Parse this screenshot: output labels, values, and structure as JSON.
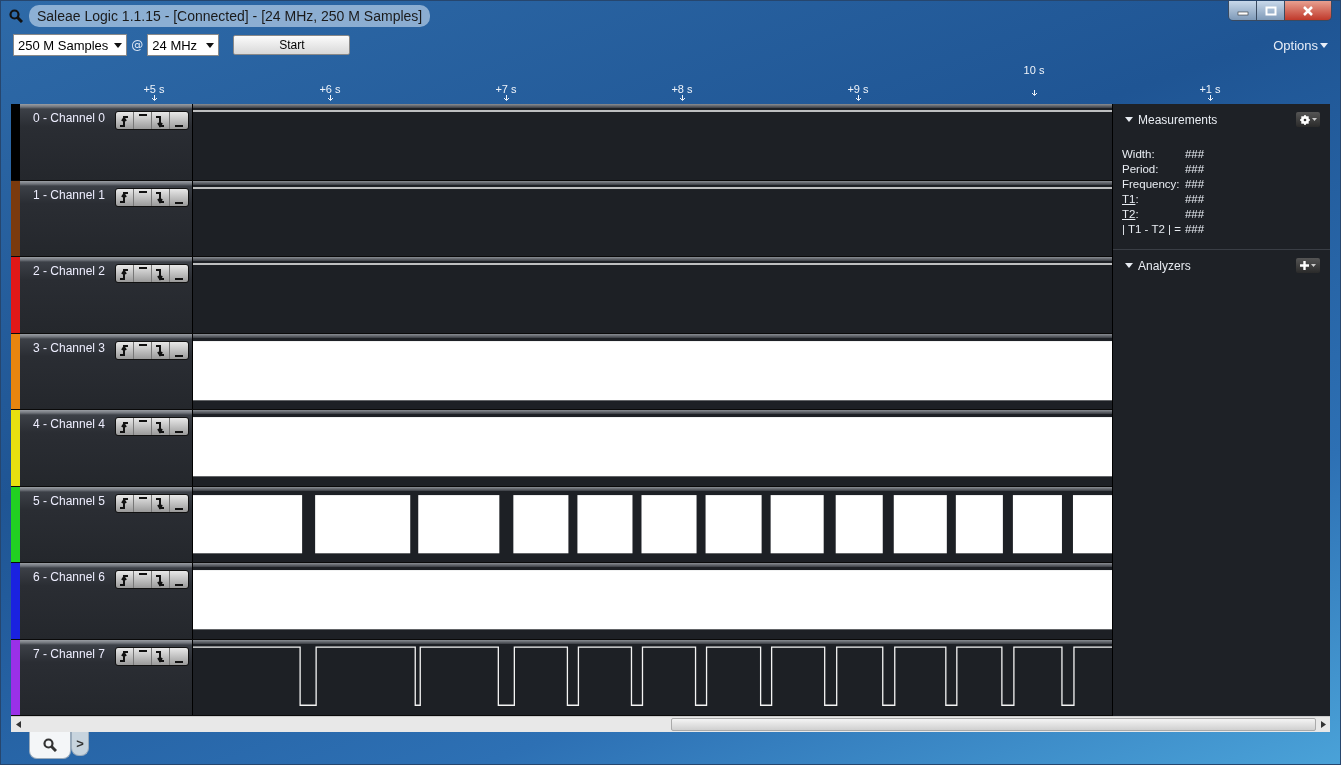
{
  "window": {
    "title": "Saleae Logic 1.1.15 - [Connected] - [24 MHz, 250 M Samples]"
  },
  "toolbar": {
    "samples": "250 M Samples",
    "at": "@",
    "rate": "24 MHz",
    "start": "Start",
    "options": "Options"
  },
  "ruler": [
    {
      "label": "+5 s",
      "kind": "minor"
    },
    {
      "label": "+6 s",
      "kind": "minor"
    },
    {
      "label": "+7 s",
      "kind": "minor"
    },
    {
      "label": "+8 s",
      "kind": "minor"
    },
    {
      "label": "+9 s",
      "kind": "minor"
    },
    {
      "label": "10 s",
      "kind": "major"
    },
    {
      "label": "+1 s",
      "kind": "minor"
    }
  ],
  "channels": [
    {
      "name": "0 - Channel 0",
      "color": "#000000",
      "kind": "idle"
    },
    {
      "name": "1 - Channel 1",
      "color": "#7a3a0e",
      "kind": "idle"
    },
    {
      "name": "2 - Channel 2",
      "color": "#e01818",
      "kind": "idle"
    },
    {
      "name": "3 - Channel 3",
      "color": "#e8850f",
      "kind": "dense"
    },
    {
      "name": "4 - Channel 4",
      "color": "#e8e010",
      "kind": "dense"
    },
    {
      "name": "5 - Channel 5",
      "color": "#22d022",
      "kind": "gapped"
    },
    {
      "name": "6 - Channel 6",
      "color": "#1a22e0",
      "kind": "dense"
    },
    {
      "name": "7 - Channel 7",
      "color": "#9a30e8",
      "kind": "pulses"
    }
  ],
  "measurements": {
    "title": "Measurements",
    "rows": [
      {
        "label": "Width:",
        "value": "###"
      },
      {
        "label": "Period:",
        "value": "###"
      },
      {
        "label": "Frequency:",
        "value": "###"
      },
      {
        "label": "T1",
        "link": true,
        "suffix": ":",
        "value": "###"
      },
      {
        "label": "T2",
        "link": true,
        "suffix": ":",
        "value": "###"
      },
      {
        "label": "| T1 - T2 | =",
        "value": "###"
      }
    ]
  },
  "analyzers": {
    "title": "Analyzers"
  },
  "tabs": [
    {
      "kind": "search",
      "selected": true
    },
    {
      "kind": "more",
      "label": ">",
      "selected": false
    }
  ]
}
